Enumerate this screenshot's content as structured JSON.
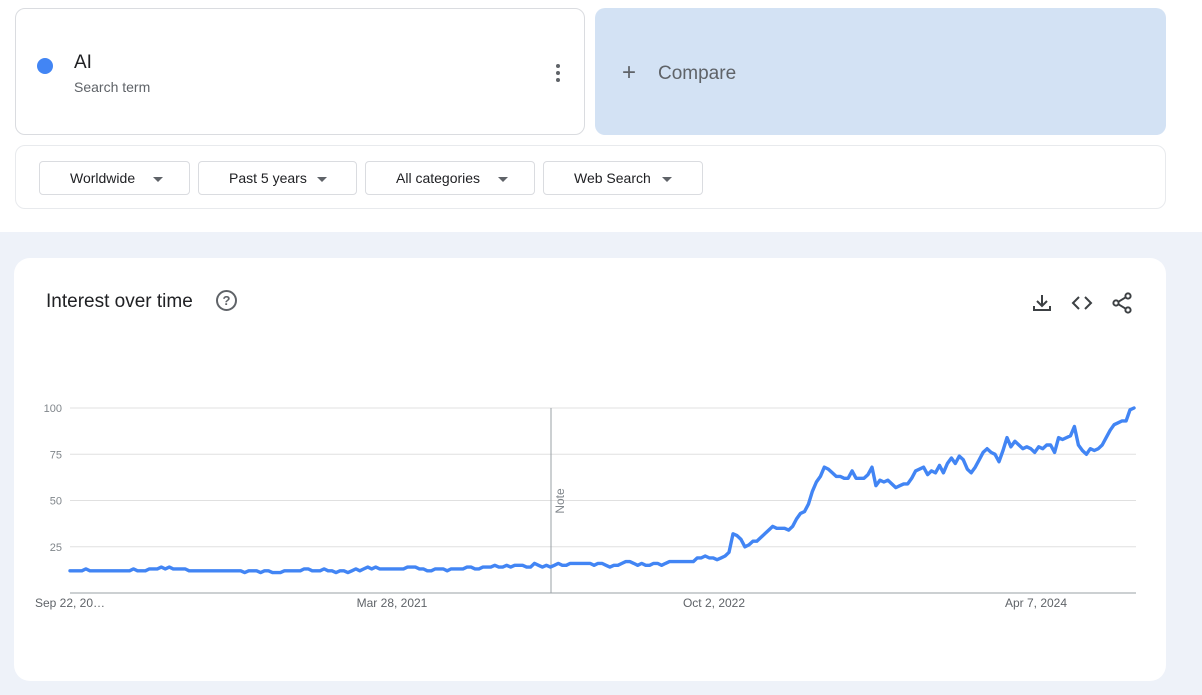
{
  "search": {
    "term": "AI",
    "term_subtitle": "Search term",
    "term_color": "#4285f4",
    "compare_label": "Compare",
    "compare_icon": "plus-icon"
  },
  "filters": {
    "region": "Worldwide",
    "time_range": "Past 5 years",
    "category": "All categories",
    "search_type": "Web Search"
  },
  "chart_section": {
    "title": "Interest over time",
    "help_icon": "help-icon",
    "tools": [
      "download-icon",
      "embed-code-icon",
      "share-icon"
    ],
    "note_label": "Note"
  },
  "chart_data": {
    "type": "line",
    "ylim": [
      0,
      100
    ],
    "yticks": [
      25,
      50,
      75,
      100
    ],
    "xtick_labels": [
      "Sep 22, 20…",
      "Mar 28, 2021",
      "Oct 2, 2022",
      "Apr 7, 2024"
    ],
    "grid": true,
    "series_color": "#4285f4",
    "series": [
      {
        "values": [
          12,
          12,
          12,
          12,
          13,
          12,
          12,
          12,
          12,
          12,
          12,
          12,
          12,
          12,
          12,
          12,
          13,
          12,
          12,
          12,
          13,
          13,
          13,
          14,
          13,
          14,
          13,
          13,
          13,
          13,
          12,
          12,
          12,
          12,
          12,
          12,
          12,
          12,
          12,
          12,
          12,
          12,
          12,
          12,
          11,
          12,
          12,
          12,
          11,
          12,
          12,
          11,
          11,
          11,
          12,
          12,
          12,
          12,
          12,
          13,
          13,
          12,
          12,
          12,
          13,
          12,
          12,
          11,
          12,
          12,
          11,
          12,
          13,
          12,
          13,
          14,
          13,
          14,
          13,
          13,
          13,
          13,
          13,
          13,
          13,
          14,
          14,
          14,
          13,
          13,
          12,
          12,
          13,
          13,
          13,
          12,
          13,
          13,
          13,
          13,
          14,
          14,
          13,
          13,
          14,
          14,
          14,
          15,
          14,
          14,
          15,
          14,
          15,
          15,
          15,
          14,
          14,
          16,
          15,
          14,
          15,
          14,
          15,
          16,
          15,
          15,
          16,
          16,
          16,
          16,
          16,
          16,
          15,
          16,
          16,
          15,
          14,
          15,
          15,
          16,
          17,
          17,
          16,
          15,
          16,
          15,
          15,
          16,
          16,
          15,
          16,
          17,
          17,
          17,
          17,
          17,
          17,
          17,
          19,
          19,
          20,
          19,
          19,
          18,
          19,
          20,
          22,
          32,
          31,
          29,
          25,
          26,
          28,
          28,
          30,
          32,
          34,
          36,
          35,
          35,
          35,
          34,
          36,
          40,
          43,
          44,
          48,
          55,
          60,
          63,
          68,
          67,
          65,
          63,
          63,
          62,
          62,
          66,
          62,
          62,
          62,
          64,
          68,
          58,
          61,
          60,
          61,
          59,
          57,
          58,
          59,
          59,
          62,
          66,
          67,
          68,
          64,
          66,
          65,
          69,
          65,
          70,
          73,
          70,
          74,
          72,
          67,
          65,
          68,
          72,
          76,
          78,
          76,
          75,
          71,
          77,
          84,
          79,
          82,
          80,
          78,
          79,
          78,
          76,
          79,
          78,
          80,
          80,
          76,
          84,
          83,
          84,
          85,
          90,
          80,
          77,
          75,
          78,
          77,
          78,
          80,
          84,
          88,
          91,
          92,
          93,
          93,
          99,
          100
        ]
      }
    ],
    "note_marker_date": "Mar 2022"
  }
}
